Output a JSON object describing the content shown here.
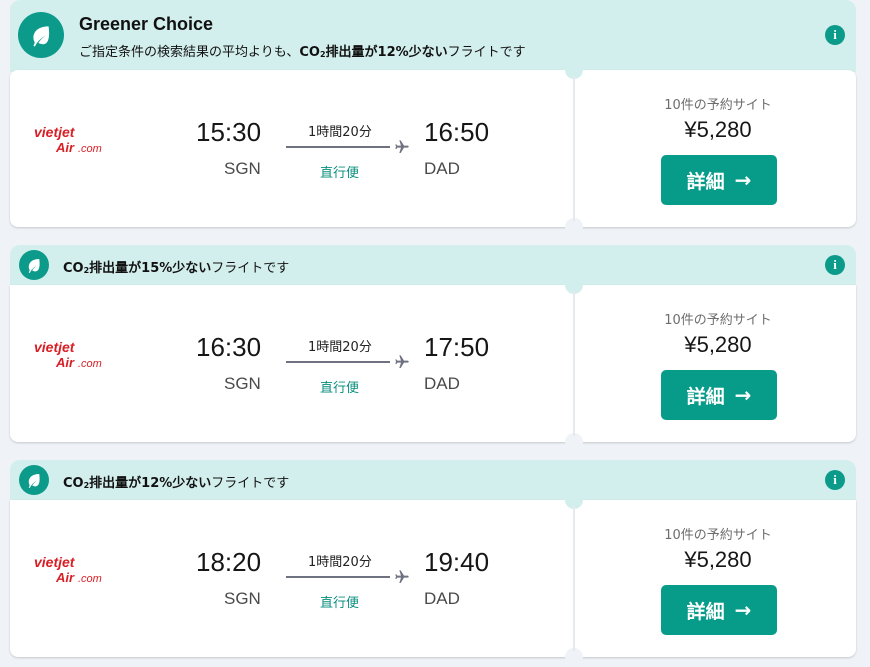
{
  "colors": {
    "accent": "#079c8a",
    "banner_bg": "#d3efed",
    "page_bg": "#eff3f8"
  },
  "results": [
    {
      "banner": {
        "type": "featured",
        "title": "Greener Choice",
        "text_pre": "ご指定条件の検索結果の平均よりも、",
        "text_bold": "CO",
        "text_sub": "2",
        "text_bold2": "排出量が12%少ない",
        "text_post": "フライトです",
        "icon": "leaf-icon",
        "info_icon": "i"
      },
      "airline_logo": "VietJet Air",
      "depart_time": "15:30",
      "depart_code": "SGN",
      "duration": "1時間20分",
      "stops": "直行便",
      "arrive_time": "16:50",
      "arrive_code": "DAD",
      "sites": "10件の予約サイト",
      "price": "¥5,280",
      "button_label": "詳細",
      "button_arrow": "→"
    },
    {
      "banner": {
        "type": "compact",
        "text_pre": "",
        "text_bold": "CO",
        "text_sub": "2",
        "text_bold2": "排出量が15%少ない",
        "text_post": "フライトです",
        "icon": "leaf-icon",
        "info_icon": "i"
      },
      "airline_logo": "VietJet Air",
      "depart_time": "16:30",
      "depart_code": "SGN",
      "duration": "1時間20分",
      "stops": "直行便",
      "arrive_time": "17:50",
      "arrive_code": "DAD",
      "sites": "10件の予約サイト",
      "price": "¥5,280",
      "button_label": "詳細",
      "button_arrow": "→"
    },
    {
      "banner": {
        "type": "compact",
        "text_pre": "",
        "text_bold": "CO",
        "text_sub": "2",
        "text_bold2": "排出量が12%少ない",
        "text_post": "フライトです",
        "icon": "leaf-icon",
        "info_icon": "i"
      },
      "airline_logo": "VietJet Air",
      "depart_time": "18:20",
      "depart_code": "SGN",
      "duration": "1時間20分",
      "stops": "直行便",
      "arrive_time": "19:40",
      "arrive_code": "DAD",
      "sites": "10件の予約サイト",
      "price": "¥5,280",
      "button_label": "詳細",
      "button_arrow": "→"
    }
  ]
}
